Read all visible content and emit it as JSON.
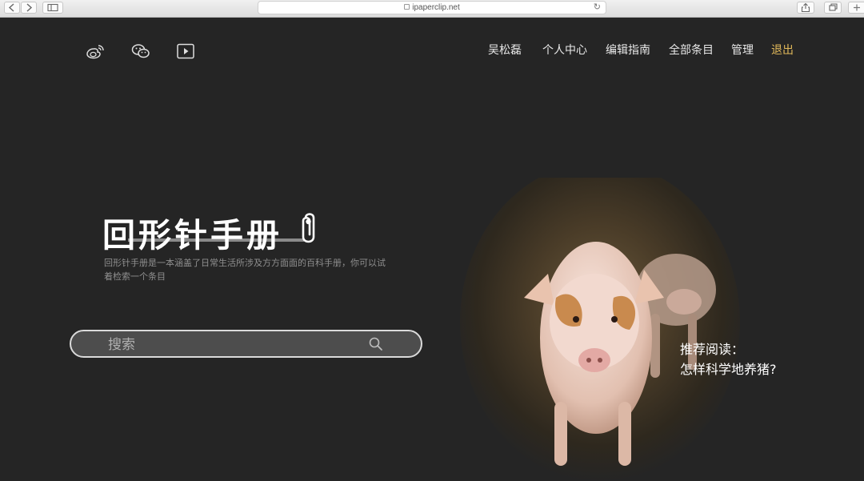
{
  "browser": {
    "url": "ipaperclip.net",
    "back_icon": "chevron-left-icon",
    "forward_icon": "chevron-right-icon",
    "sidebar_icon": "sidebar-icon",
    "reload_icon": "reload-icon",
    "share_icon": "share-icon",
    "tabs_icon": "tabs-icon",
    "new_tab_icon": "plus-icon"
  },
  "social": [
    {
      "icon": "weibo-icon"
    },
    {
      "icon": "wechat-icon"
    },
    {
      "icon": "video-play-icon"
    }
  ],
  "nav": {
    "user": "吴松磊",
    "profile": "个人中心",
    "guide": "编辑指南",
    "all_entries": "全部条目",
    "admin": "管理",
    "logout": "退出"
  },
  "hero": {
    "logo_text": "回形针手册",
    "description": "回形针手册是一本涵盖了日常生活所涉及方方面面的百科手册，你可以试着检索一个条目"
  },
  "search": {
    "placeholder": "搜索",
    "button_icon": "search-icon"
  },
  "recommend": {
    "label": "推荐阅读：",
    "title": "怎样科学地养猪?"
  },
  "colors": {
    "background": "#252525",
    "accent": "#e2b95a",
    "text": "#e8e8e8"
  }
}
